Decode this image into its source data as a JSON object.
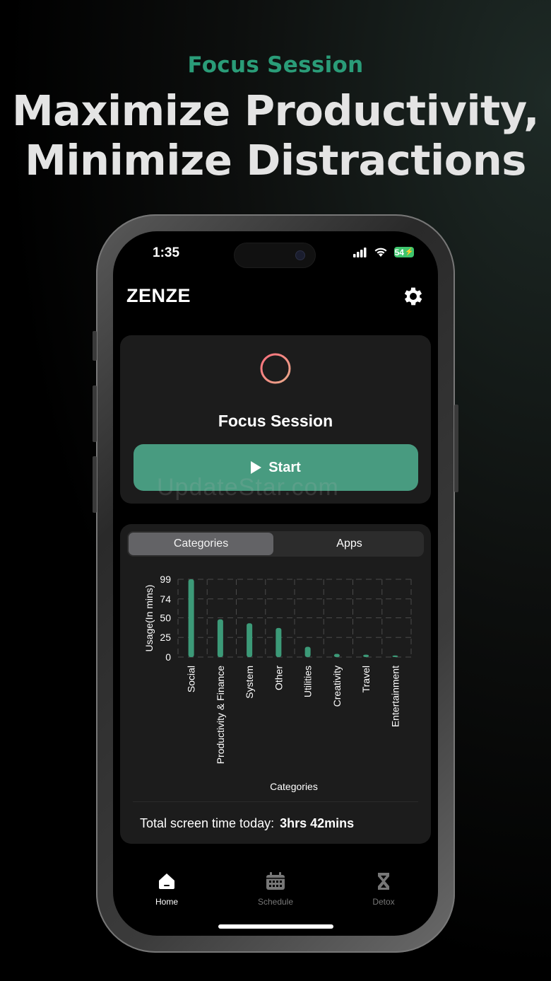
{
  "promo": {
    "kicker": "Focus Session",
    "title_line1": "Maximize Productivity,",
    "title_line2": "Minimize Distractions"
  },
  "status_bar": {
    "time": "1:35",
    "battery": "54"
  },
  "header": {
    "app_name": "ZENZE",
    "settings_icon": "gear-icon"
  },
  "focus_card": {
    "icon": "crosshair-icon",
    "title": "Focus Session",
    "start_label": "Start"
  },
  "watermark": "UpdateStar.com",
  "usage_card": {
    "tabs": [
      {
        "label": "Categories",
        "active": true
      },
      {
        "label": "Apps",
        "active": false
      }
    ],
    "total_label": "Total screen time today:",
    "total_value": "3hrs 42mins"
  },
  "chart_data": {
    "type": "bar",
    "categories": [
      "Social",
      "Productivity & Finance",
      "System",
      "Other",
      "Utilities",
      "Creativity",
      "Travel",
      "Entertainment"
    ],
    "values": [
      99,
      48,
      43,
      37,
      13,
      4,
      3,
      2
    ],
    "xlabel": "Categories",
    "ylabel": "Usage(In mins)",
    "yticks": [
      0,
      25,
      50,
      74,
      99
    ],
    "ylim": [
      0,
      99
    ],
    "grid": true,
    "bar_color": "#3c9a78"
  },
  "tab_bar": {
    "items": [
      {
        "label": "Home",
        "icon": "home-icon",
        "active": true
      },
      {
        "label": "Schedule",
        "icon": "calendar-icon",
        "active": false
      },
      {
        "label": "Detox",
        "icon": "hourglass-icon",
        "active": false
      }
    ]
  },
  "colors": {
    "accent": "#489b80",
    "kicker": "#2a9c78",
    "card_bg": "#1c1c1c"
  }
}
